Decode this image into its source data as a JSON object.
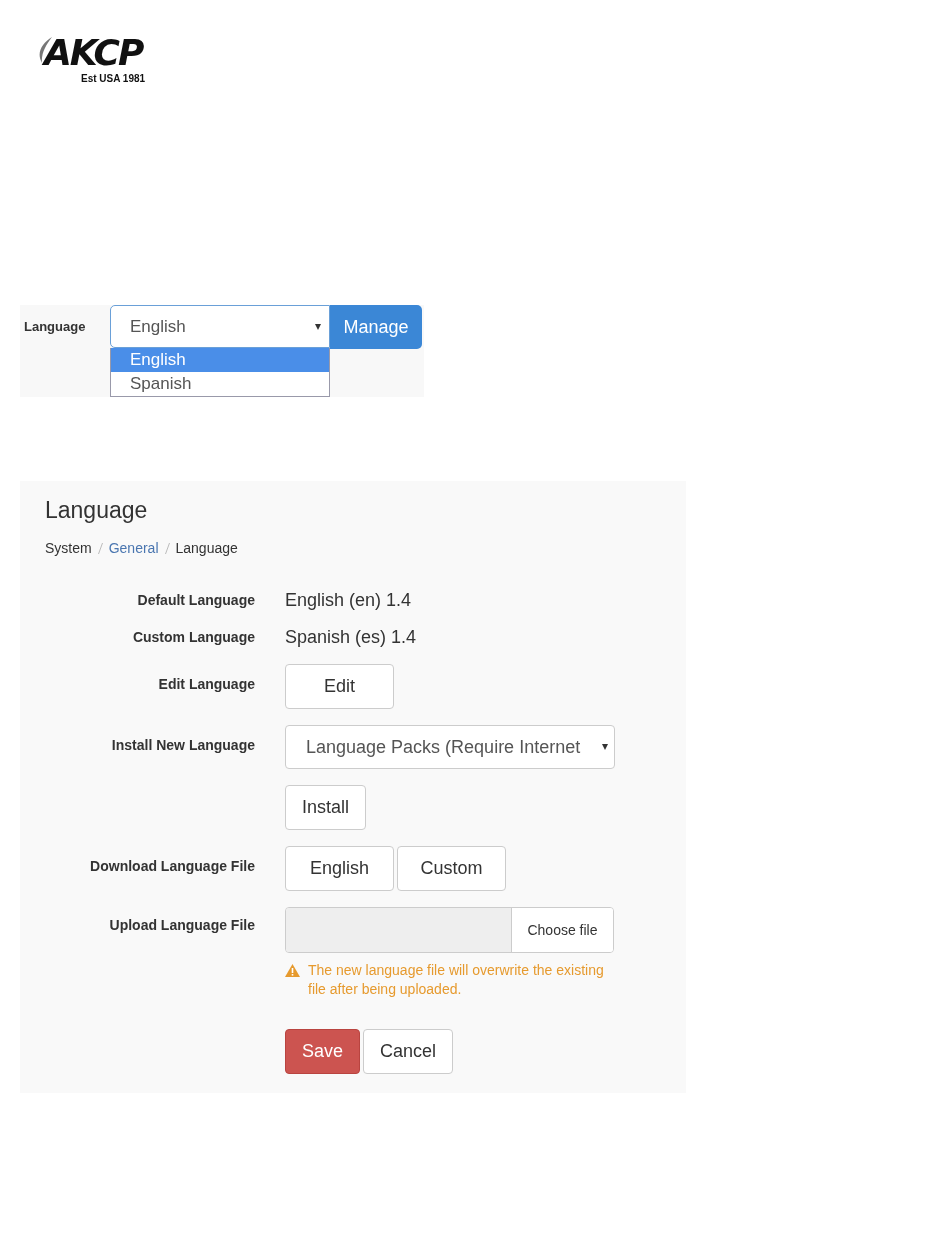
{
  "logo": {
    "name": "AKCP",
    "tagline": "Est USA 1981"
  },
  "language_selector": {
    "label": "Language",
    "value": "English",
    "manage_button": "Manage",
    "options": [
      {
        "label": "English",
        "selected": true
      },
      {
        "label": "Spanish",
        "selected": false
      }
    ]
  },
  "language_page": {
    "title": "Language",
    "breadcrumb": [
      {
        "label": "System",
        "kind": "text"
      },
      {
        "label": "General",
        "kind": "link"
      },
      {
        "label": "Language",
        "kind": "text"
      }
    ],
    "rows": [
      {
        "kind": "text",
        "label": "Default Language",
        "value": "English (en) 1.4"
      },
      {
        "kind": "text",
        "label": "Custom Language",
        "value": "Spanish (es) 1.4"
      },
      {
        "kind": "buttons",
        "label": "Edit Language",
        "buttons": [
          "Edit"
        ]
      },
      {
        "kind": "select",
        "label": "Install New Language",
        "value": "Language Packs (Require Internet"
      },
      {
        "kind": "buttons",
        "buttons": [
          "Install"
        ]
      },
      {
        "kind": "buttons",
        "label": "Download Language File",
        "buttons": [
          "English",
          "Custom"
        ]
      },
      {
        "kind": "file",
        "label": "Upload Language File",
        "button": "Choose file",
        "warning": "The new language file will overwrite the existing file after being uploaded."
      }
    ],
    "actions": [
      {
        "label": "Save",
        "kind": "primary"
      },
      {
        "label": "Cancel",
        "kind": "default"
      }
    ]
  }
}
